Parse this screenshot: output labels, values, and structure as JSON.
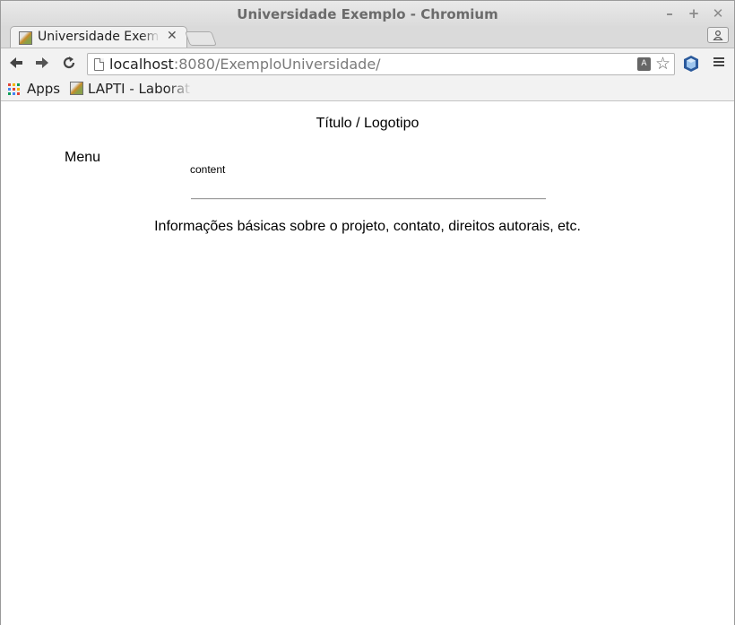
{
  "window": {
    "title": "Universidade Exemplo - Chromium",
    "minimize": "–",
    "maximize": "+",
    "close": "✕"
  },
  "tabs": [
    {
      "label": "Universidade Exemplo",
      "active": true,
      "close": "✕"
    }
  ],
  "toolbar": {
    "url_host": "localhost",
    "url_rest": ":8080/ExemploUniversidade/",
    "translate_glyph": "A",
    "star_glyph": "☆",
    "menu_glyph": "≡"
  },
  "bookmarks": {
    "apps_label": "Apps",
    "items": [
      {
        "label": "LAPTI - Laboratório"
      }
    ]
  },
  "page": {
    "header": "Título / Logotipo",
    "menu": "Menu",
    "content": "content",
    "footer": "Informações básicas sobre o projeto, contato, direitos autorais, etc."
  }
}
